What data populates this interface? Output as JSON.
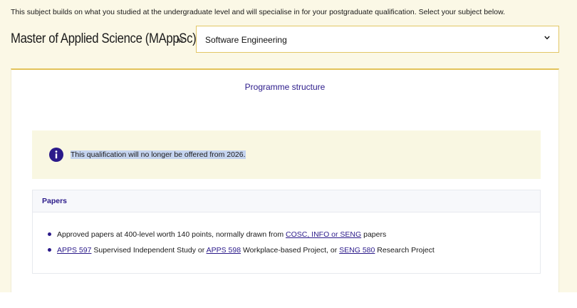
{
  "intro_text": "This subject builds on what you studied at the undergraduate level and will specialise in for your postgraduate qualification. Select your subject below.",
  "qualification": {
    "title": "Master of Applied Science (MAppSc)",
    "in_label": "in:",
    "subject_selected": "Software Engineering",
    "select_icon": "chevron-down-icon"
  },
  "tabs": {
    "programme_structure": "Programme structure"
  },
  "notice": {
    "icon": "info-icon",
    "text": "This qualification will no longer be offered from 2026."
  },
  "papers": {
    "heading": "Papers",
    "items": [
      {
        "pre": "Approved papers at 400-level worth 140 points, normally drawn from ",
        "link": "COSC, INFO or SENG",
        "post": " papers"
      },
      {
        "link1": "APPS 597",
        "text1": " Supervised Independent Study or ",
        "link2": "APPS 598",
        "text2": " Workplace-based Project, or ",
        "link3": "SENG 580",
        "text3": " Research Project"
      }
    ]
  },
  "colors": {
    "accent": "#2b1a8a",
    "page_background": "#fbf8e6",
    "border_gold": "#e2c35a"
  }
}
